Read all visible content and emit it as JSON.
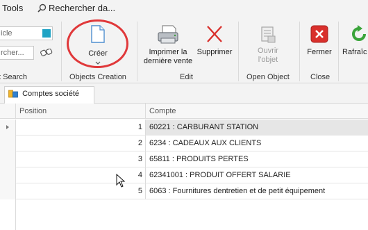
{
  "menubar": {
    "tools_label": "Tools",
    "search_label": "Rechercher da..."
  },
  "ribbon": {
    "field1_value": "icle",
    "field2_value": "rcher...",
    "group_search_label": "t Search",
    "create_label": "Créer",
    "group_objects_creation_label": "Objects Creation",
    "print_label_line1": "Imprimer la",
    "print_label_line2": "dernière vente",
    "delete_label": "Supprimer",
    "group_edit_label": "Edit",
    "open_label_line1": "Ouvrir",
    "open_label_line2": "l'objet",
    "group_open_object_label": "Open Object",
    "close_label": "Fermer",
    "group_close_label": "Close",
    "refresh_label": "Rafraîc"
  },
  "tab": {
    "label": "Comptes société"
  },
  "grid": {
    "columns": [
      "Position",
      "Compte"
    ],
    "rows": [
      {
        "position": "1",
        "compte": "60221 : CARBURANT STATION"
      },
      {
        "position": "2",
        "compte": "6234 : CADEAUX AUX CLIENTS"
      },
      {
        "position": "3",
        "compte": "65811 : PRODUITS PERTES"
      },
      {
        "position": "4",
        "compte": "62341001 : PRODUIT OFFERT SALARIE"
      },
      {
        "position": "5",
        "compte": "6063 : Fournitures dentretien et de petit équipement"
      }
    ]
  },
  "colors": {
    "accent_red": "#e0383a",
    "close_red": "#d9302c",
    "refresh_green": "#3aa43a",
    "field_blue": "#1fa3c4"
  },
  "icons": [
    "search-icon",
    "binoculars-icon",
    "new-document-icon",
    "printer-icon",
    "delete-x-icon",
    "open-object-icon",
    "close-icon",
    "refresh-icon",
    "folder-tab-icon",
    "row-indicator-arrow-icon",
    "mouse-cursor-icon"
  ]
}
